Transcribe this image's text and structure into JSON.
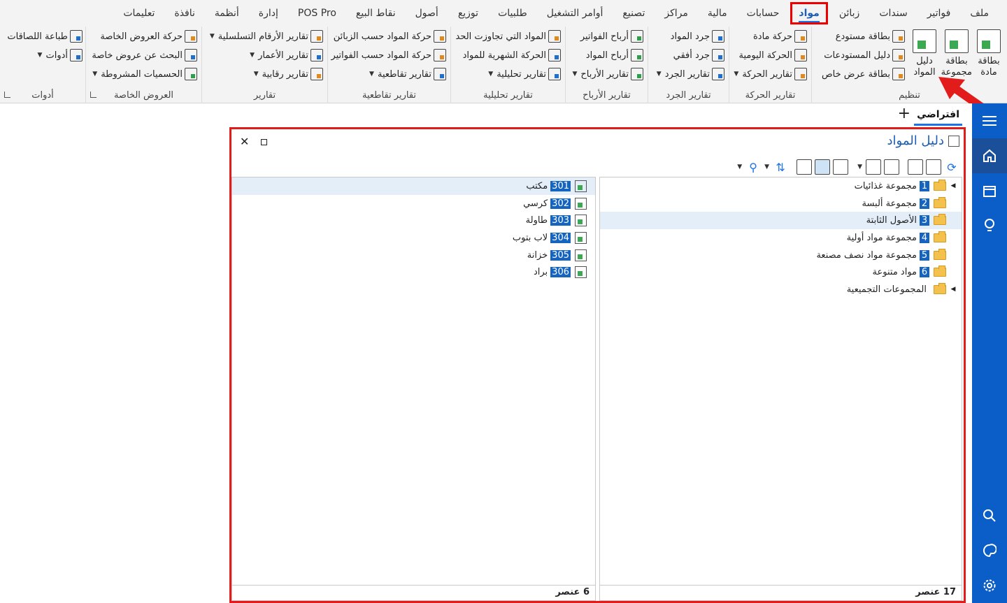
{
  "menu": {
    "items": [
      "ملف",
      "فواتير",
      "سندات",
      "زبائن",
      "مواد",
      "حسابات",
      "مالية",
      "مراكز",
      "تصنيع",
      "أوامر التشغيل",
      "طلبيات",
      "توزيع",
      "أصول",
      "نقاط البيع",
      "POS Pro",
      "إدارة",
      "أنظمة",
      "نافذة",
      "تعليمات"
    ],
    "active": "مواد"
  },
  "ribbon": {
    "organize": {
      "label": "تنظيم",
      "material_card": "بطاقة مادة",
      "group_card": "بطاقة مجموعة",
      "materials_guide": "دليل المواد",
      "warehouse_card": "بطاقة مستودع",
      "warehouses_guide": "دليل المستودعات",
      "special_offer_card": "بطاقة عرض خاص"
    },
    "movement": {
      "label": "تقارير الحركة",
      "item_movement": "حركة مادة",
      "daily_movement": "الحركة اليومية",
      "movement_reports": "تقارير الحركة"
    },
    "inventory": {
      "label": "تقارير الجرد",
      "materials_inventory": "جرد المواد",
      "horizontal_inventory": "جرد أفقي",
      "inventory_reports": "تقارير الجرد"
    },
    "profits": {
      "label": "تقارير الأرباح",
      "invoice_profits": "أرباح الفواتير",
      "material_profits": "أرباح المواد",
      "profit_reports": "تقارير الأرباح"
    },
    "analytic": {
      "label": "تقارير تحليلية",
      "over_limit": "المواد التي تجاوزت الحد",
      "monthly_movement": "الحركة الشهرية للمواد",
      "analytic_reports": "تقارير تحليلية"
    },
    "cross": {
      "label": "تقارير تقاطعية",
      "by_customers": "حركة المواد حسب الزبائن",
      "by_invoices": "حركة المواد حسب الفواتير",
      "cross_reports": "تقارير تقاطعية"
    },
    "reports": {
      "label": "تقارير",
      "serial_reports": "تقارير الأرقام التسلسلية",
      "age_reports": "تقارير الأعمار",
      "control_reports": "تقارير رقابية"
    },
    "offers": {
      "label": "العروض الخاصة",
      "offers_movement": "حركة العروض الخاصة",
      "search_offer": "البحث عن عروض خاصة",
      "conditional_discounts": "الحسميات المشروطة"
    },
    "tools": {
      "label": "أدوات",
      "print_labels": "طباعة اللصاقات",
      "tools": "أدوات"
    }
  },
  "workspace": {
    "tab_label": "افتراضي",
    "add_symbol": "+"
  },
  "window": {
    "title": "دليل المواد",
    "groups": [
      {
        "code": "1",
        "name": "مجموعة غذائيات",
        "expandable": true,
        "selected": false
      },
      {
        "code": "2",
        "name": "مجموعة ألبسة",
        "expandable": false,
        "selected": false
      },
      {
        "code": "3",
        "name": "الأصول الثابتة",
        "expandable": false,
        "selected": true
      },
      {
        "code": "4",
        "name": "مجموعة مواد أولية",
        "expandable": false,
        "selected": false
      },
      {
        "code": "5",
        "name": "مجموعة مواد نصف مصنعة",
        "expandable": false,
        "selected": false
      },
      {
        "code": "6",
        "name": "مواد متنوعة",
        "expandable": false,
        "selected": false
      },
      {
        "code": "",
        "name": "المجموعات التجميعية",
        "expandable": true,
        "selected": false
      }
    ],
    "items": [
      {
        "code": "301",
        "name": "مكتب",
        "selected": true
      },
      {
        "code": "302",
        "name": "كرسي",
        "selected": false
      },
      {
        "code": "303",
        "name": "طاولة",
        "selected": false
      },
      {
        "code": "304",
        "name": "لاب بتوب",
        "selected": false
      },
      {
        "code": "305",
        "name": "خزانة",
        "selected": false
      },
      {
        "code": "306",
        "name": "براد",
        "selected": false
      }
    ],
    "groups_count": "17 عنصر",
    "items_count": "6 عنصر"
  },
  "colors": {
    "accent": "#1a73e8",
    "sidebar": "#0b5ec7",
    "highlight": "#e21b1b",
    "code_badge": "#1565c0"
  }
}
